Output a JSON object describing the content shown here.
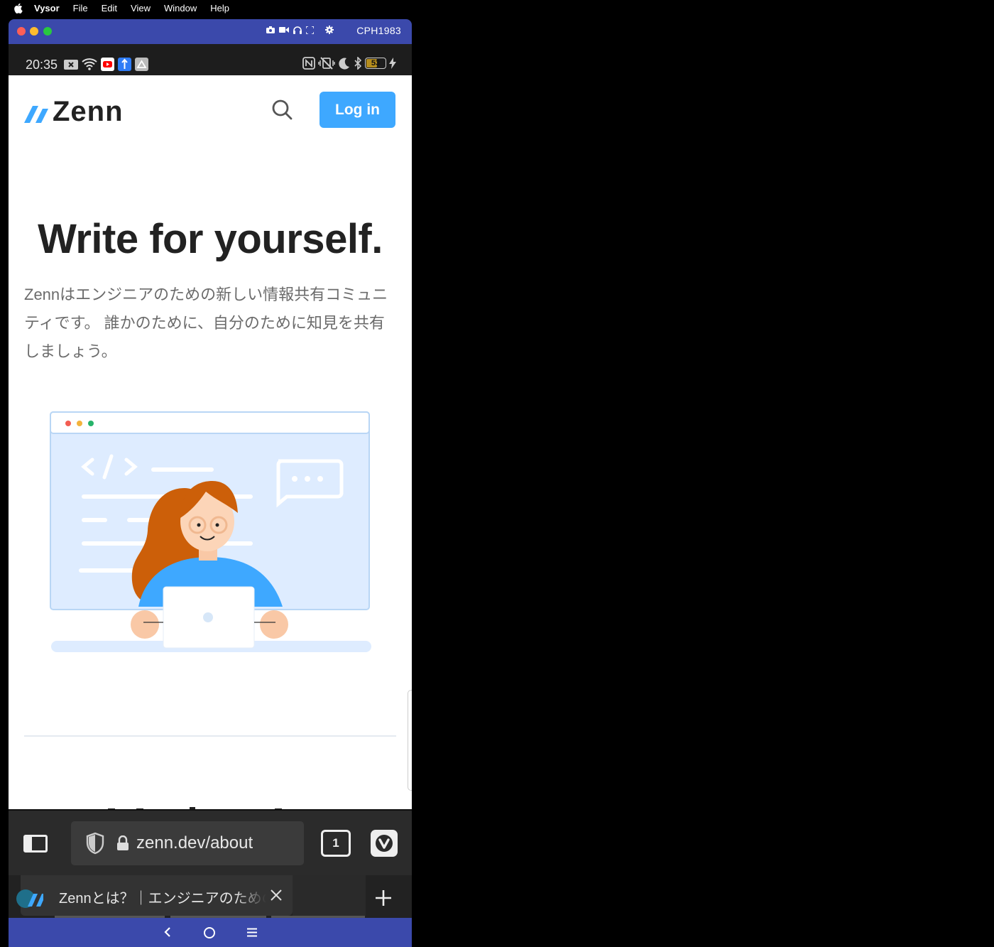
{
  "mac_menubar": {
    "app_name": "Vysor",
    "items": [
      "File",
      "Edit",
      "View",
      "Window",
      "Help"
    ]
  },
  "vysor_window": {
    "device_name": "CPH1983"
  },
  "android_status": {
    "time": "20:35",
    "battery_level": "53"
  },
  "page": {
    "logo_text": "Zenn",
    "login_label": "Log in",
    "headline": "Write for yourself.",
    "description": "Zennはエンジニアのための新しい情報共有コミュニティです。 誰かのために、自分のために知見を共有しましょう。"
  },
  "browser": {
    "url": "zenn.dev/about",
    "tab_count": "1",
    "tab_title": "Zennとは？｜エンジニアのための情報共有コミュニティ"
  },
  "colors": {
    "zenn_blue": "#3ea8ff",
    "vysor_purple": "#3b49ab",
    "browser_dark": "#2b2b2b"
  }
}
